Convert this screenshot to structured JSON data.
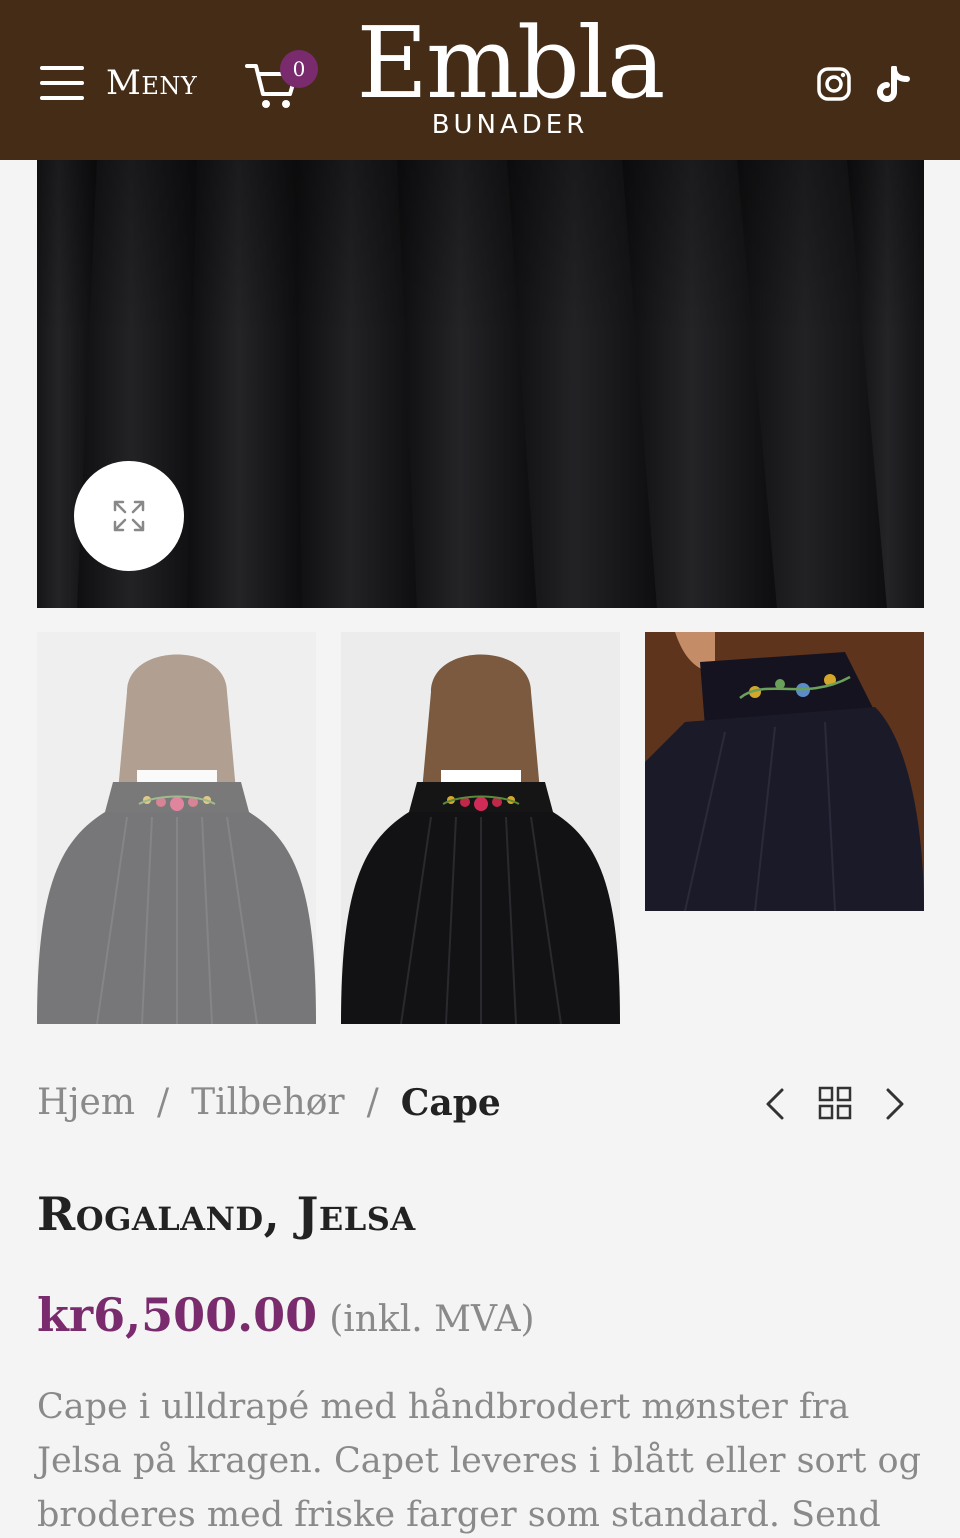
{
  "header": {
    "menu_label": "Meny",
    "cart_count": "0",
    "logo_main": "Embla",
    "logo_sub": "BUNADER",
    "background": "#452c16"
  },
  "gallery": {
    "expand_icon": "expand-arrows-icon",
    "thumbnails": [
      "cape-back-view",
      "cape-back-view-selected",
      "cape-collar-detail"
    ]
  },
  "breadcrumb": {
    "items": [
      "Hjem",
      "Tilbehør",
      "Cape"
    ],
    "separator": "/"
  },
  "product": {
    "title": "Rogaland, Jelsa",
    "price": "kr6,500.00",
    "price_note": "(inkl. MVA)",
    "price_color": "#7a2b6e",
    "description": "Cape i ulldrapé med håndbrodert mønster fra Jelsa på kragen. Capet leveres i blått eller sort og broderes med friske farger som standard. Send oss en melding i"
  }
}
